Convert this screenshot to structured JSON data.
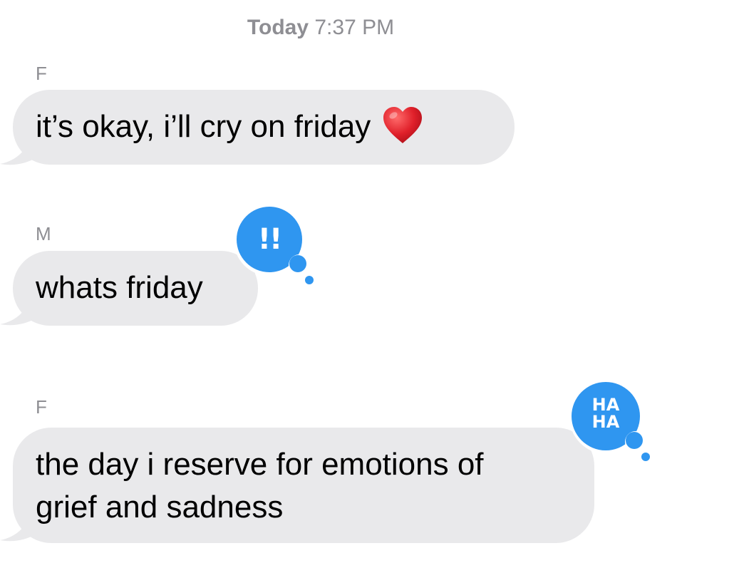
{
  "header": {
    "timestamp_day": "Today",
    "timestamp_time": "7:37 PM"
  },
  "messages": [
    {
      "sender": "F",
      "text": "it’s okay, i’ll cry on friday",
      "emoji": "heart-emoji"
    },
    {
      "sender": "M",
      "text": "whats friday",
      "tapback": {
        "label": "!!",
        "icon": "exclamation-tapback-icon"
      }
    },
    {
      "sender": "F",
      "line1": "the day i reserve for emotions of",
      "line2": "grief and sadness",
      "tapback": {
        "label_top": "HA",
        "label_bottom": "HA",
        "icon": "haha-tapback-icon"
      }
    }
  ],
  "colors": {
    "received_bubble": "#e9e9eb",
    "tapback_blue": "#2f96f0",
    "timestamp_gray": "#8e8e93",
    "heart_red": "#e0202a"
  }
}
